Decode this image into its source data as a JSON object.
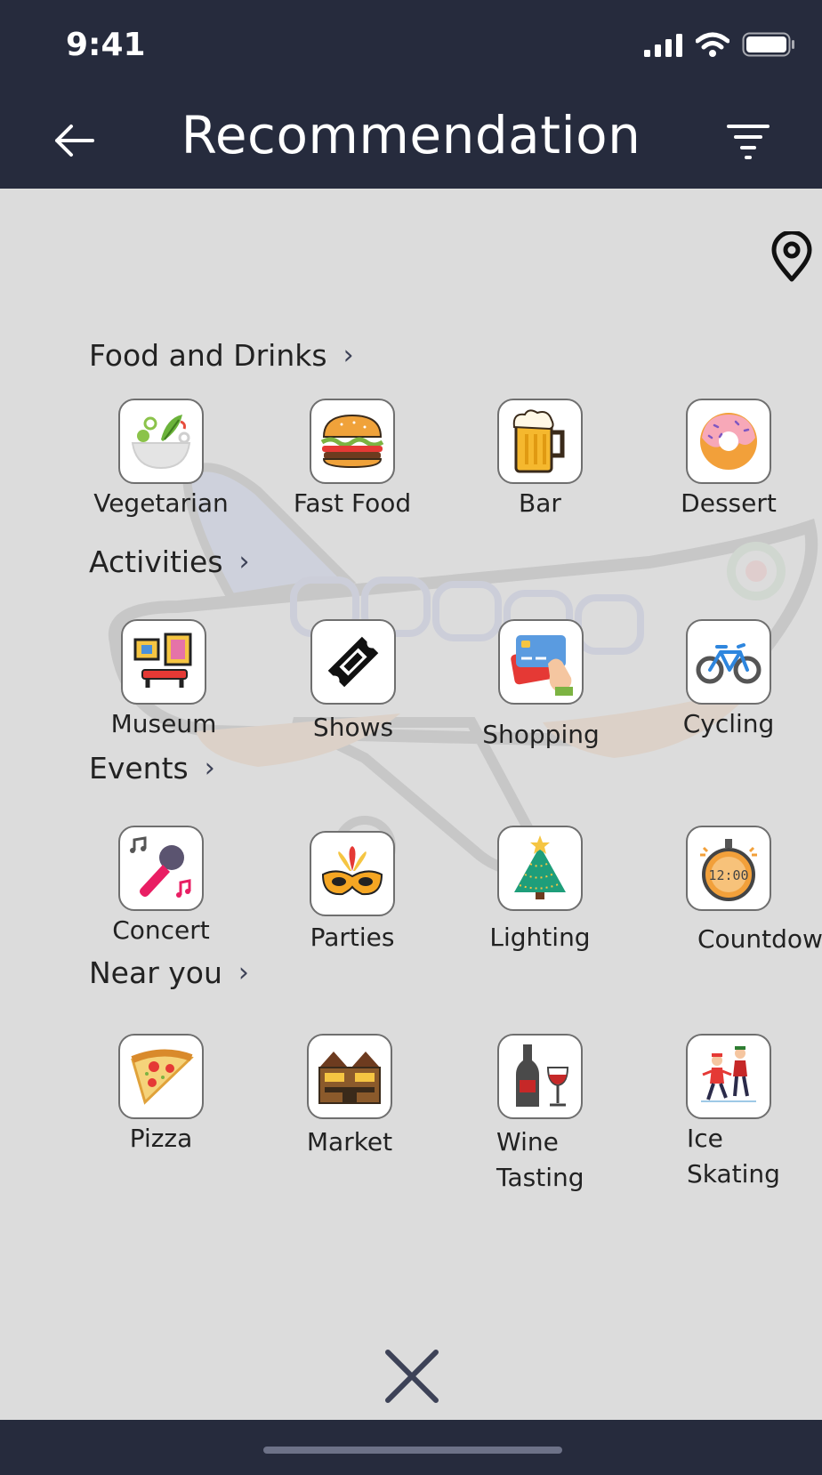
{
  "status": {
    "time": "9:41"
  },
  "header": {
    "title": "Recommendation"
  },
  "sections": [
    {
      "title": "Food and Drinks",
      "items": [
        {
          "label": "Vegetarian",
          "icon": "salad-icon"
        },
        {
          "label": "Fast Food",
          "icon": "burger-icon"
        },
        {
          "label": "Bar",
          "icon": "beer-icon"
        },
        {
          "label": "Dessert",
          "icon": "donut-icon"
        }
      ]
    },
    {
      "title": "Activities",
      "items": [
        {
          "label": "Museum",
          "icon": "museum-icon"
        },
        {
          "label": "Shows",
          "icon": "ticket-icon"
        },
        {
          "label": "Shopping",
          "icon": "credit-card-icon"
        },
        {
          "label": "Cycling",
          "icon": "bicycle-icon"
        }
      ]
    },
    {
      "title": "Events",
      "items": [
        {
          "label": "Concert",
          "icon": "microphone-icon"
        },
        {
          "label": "Parties",
          "icon": "mask-icon"
        },
        {
          "label": "Lighting",
          "icon": "christmas-tree-icon"
        },
        {
          "label": "Countdown",
          "icon": "clock-icon"
        }
      ]
    },
    {
      "title": "Near you",
      "items": [
        {
          "label": "Pizza",
          "icon": "pizza-icon"
        },
        {
          "label": "Market",
          "icon": "market-icon"
        },
        {
          "label": "Wine\nTasting",
          "icon": "wine-icon"
        },
        {
          "label": "Ice\nSkating",
          "icon": "ice-skating-icon"
        }
      ]
    }
  ],
  "colors": {
    "bar": "#262b3d",
    "background": "#dcdcdc"
  }
}
